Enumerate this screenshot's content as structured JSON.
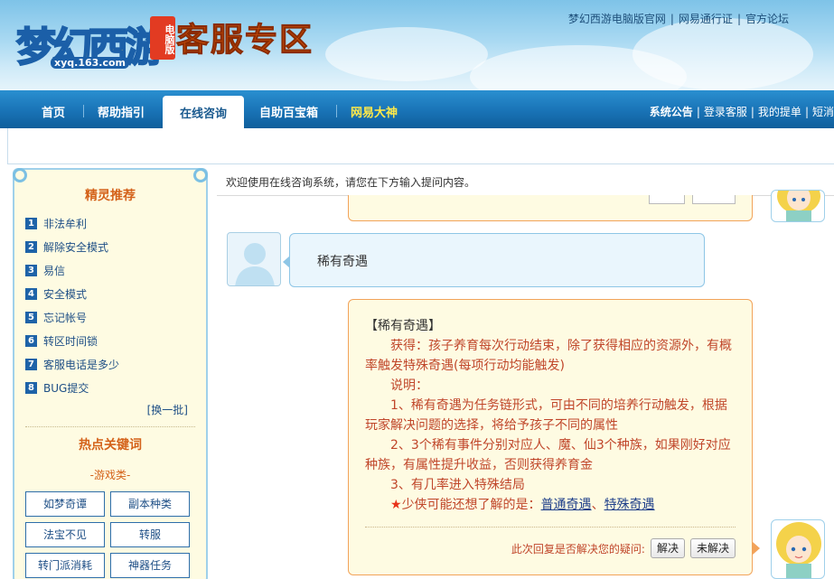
{
  "header": {
    "logo_text": "梦幻西游",
    "logo_badge": "电脑版",
    "logo_url": "xyq.163.com",
    "site_title": "客服专区",
    "top_links": [
      "梦幻西游电脑版官网",
      "网易通行证",
      "官方论坛"
    ]
  },
  "nav": {
    "items": [
      "首页",
      "帮助指引",
      "在线咨询",
      "自助百宝箱",
      "网易大神"
    ],
    "active_index": 2,
    "right_links": [
      "系统公告",
      "登录客服",
      "我的提单",
      "短消"
    ]
  },
  "sidebar": {
    "title": "精灵推荐",
    "items": [
      {
        "num": "1",
        "label": "非法牟利"
      },
      {
        "num": "2",
        "label": "解除安全模式"
      },
      {
        "num": "3",
        "label": "易信"
      },
      {
        "num": "4",
        "label": "安全模式"
      },
      {
        "num": "5",
        "label": "忘记帐号"
      },
      {
        "num": "6",
        "label": "转区时间锁"
      },
      {
        "num": "7",
        "label": "客服电话是多少"
      },
      {
        "num": "8",
        "label": "BUG提交"
      }
    ],
    "switch_label": "[换一批]",
    "hot_title": "热点关键词",
    "category": "-游戏类-",
    "keywords": [
      "如梦奇谭",
      "副本种类",
      "法宝不见",
      "转服",
      "转门派消耗",
      "神器任务"
    ]
  },
  "main": {
    "welcome": "欢迎使用在线咨询系统，请您在下方输入提问内容。",
    "old_buttons": [
      "解决",
      "未解决"
    ],
    "user_message": "稀有奇遇",
    "reply": {
      "heading": "【稀有奇遇】",
      "p1": "获得：孩子养育每次行动结束，除了获得相应的资源外，有概率触发特殊奇遇(每项行动均能触发)",
      "p2": "说明：",
      "p3": "1、稀有奇遇为任务链形式，可由不同的培养行动触发，根据玩家解决问题的选择，将给予孩子不同的属性",
      "p4": "2、3个稀有事件分别对应人、魔、仙3个种族，如果刚好对应种族，有属性提升收益，否则获得养育金",
      "p5": "3、有几率进入特殊结局",
      "more_prefix": "少侠可能还想了解的是：",
      "more_link1": "普通奇遇",
      "more_sep": "、",
      "more_link2": "特殊奇遇",
      "feedback_question": "此次回复是否解决您的疑问:",
      "btn_solved": "解决",
      "btn_unsolved": "未解决"
    }
  },
  "colors": {
    "nav_blue": "#1973b6",
    "accent_orange": "#d4621a",
    "reply_text": "#c0462a",
    "link_blue": "#1e4f86"
  }
}
